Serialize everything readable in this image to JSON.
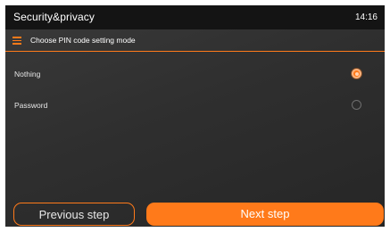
{
  "app": {
    "title": "Security&privacy",
    "time": "14:16"
  },
  "section": {
    "title": "Choose PIN code setting mode"
  },
  "options": [
    {
      "label": "Nothing",
      "selected": true
    },
    {
      "label": "Password",
      "selected": false
    }
  ],
  "buttons": {
    "previous": "Previous step",
    "next": "Next step"
  },
  "colors": {
    "accent": "#ff7a1a",
    "topbar": "#141414",
    "background": "#333333"
  }
}
